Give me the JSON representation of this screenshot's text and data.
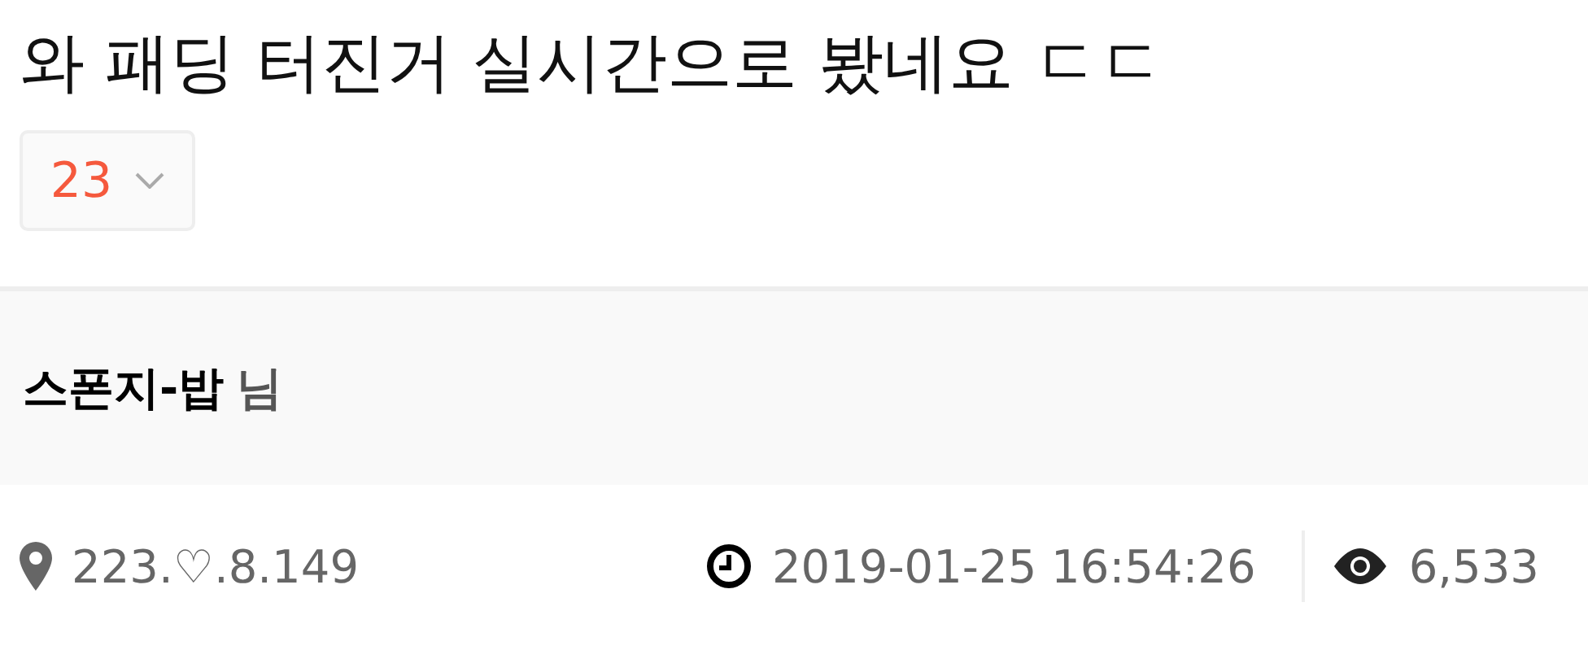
{
  "post": {
    "title": "와 패딩 터진거 실시간으로 봤네요 ㄷㄷ",
    "comment_count": "23"
  },
  "author": {
    "name": "스폰지-밥",
    "suffix": "님"
  },
  "meta": {
    "ip": "223.♡.8.149",
    "datetime": "2019-01-25 16:54:26",
    "views": "6,533"
  }
}
